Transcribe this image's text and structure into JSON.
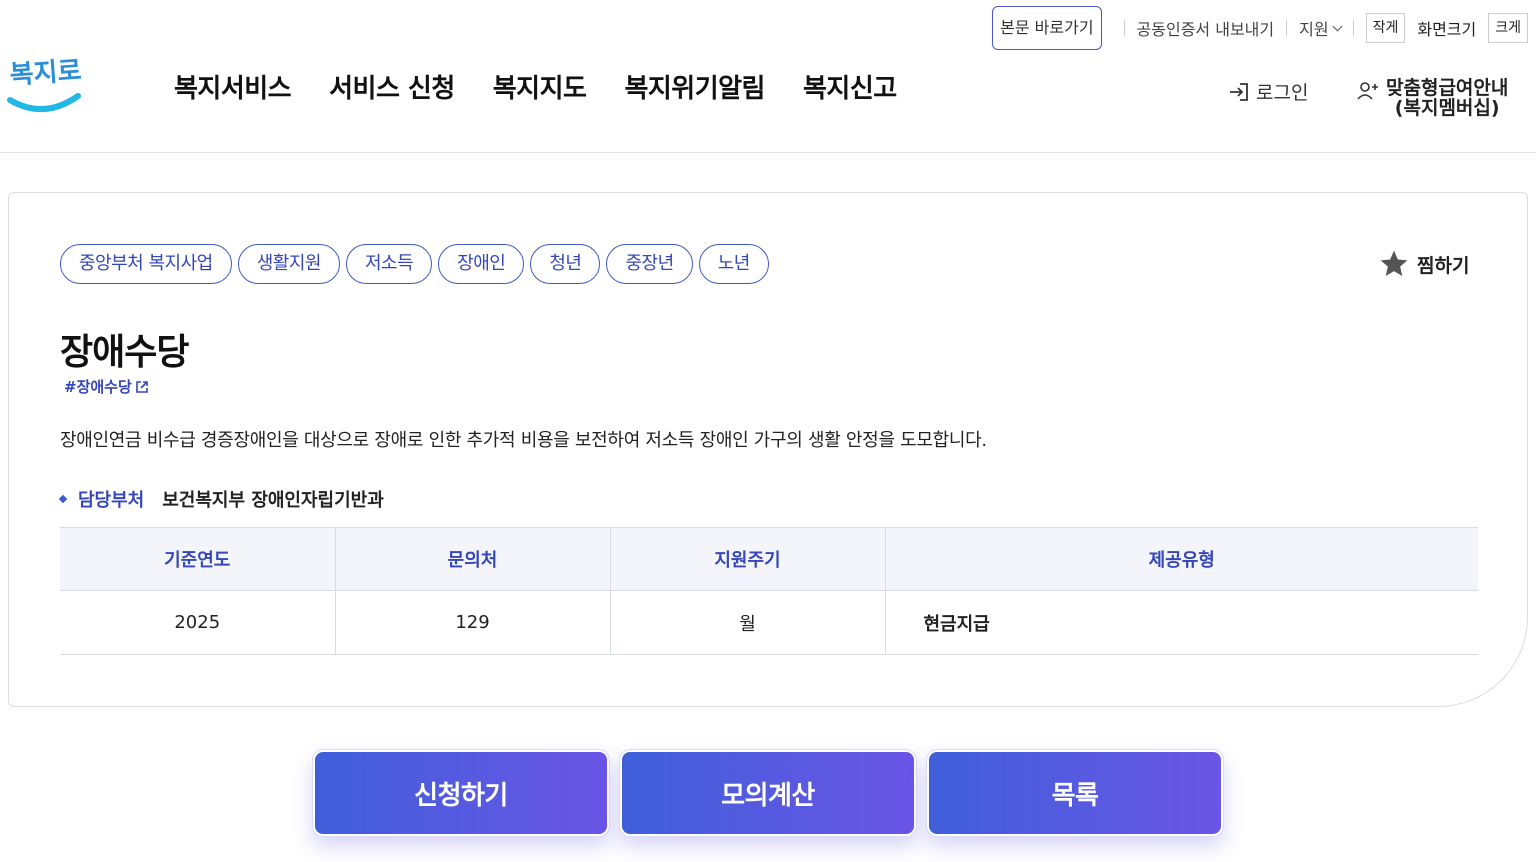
{
  "util_bar": {
    "skip_link": "본문 바로가기",
    "cert_export": "공동인증서 내보내기",
    "support": "지원",
    "size_small": "작게",
    "size_label": "화면크기",
    "size_large": "크게"
  },
  "logo": {
    "text": "복지로"
  },
  "nav": {
    "items": [
      "복지서비스",
      "서비스 신청",
      "복지지도",
      "복지위기알림",
      "복지신고"
    ],
    "login": "로그인",
    "member_line1": "맞춤형급여안내",
    "member_line2": "(복지멤버십)"
  },
  "detail": {
    "tags": [
      "중앙부처 복지사업",
      "생활지원",
      "저소득",
      "장애인",
      "청년",
      "중장년",
      "노년"
    ],
    "favorite": "찜하기",
    "title": "장애수당",
    "hashtag": "#장애수당",
    "description": "장애인연금 비수급 경증장애인을 대상으로 장애로 인한 추가적 비용을 보전하여 저소득 장애인 가구의 생활 안정을 도모합니다.",
    "dept_label": "담당부처",
    "dept_value": "보건복지부 장애인자립기반과",
    "table": {
      "headers": [
        "기준연도",
        "문의처",
        "지원주기",
        "제공유형"
      ],
      "row": [
        "2025",
        "129",
        "월",
        "현금지급"
      ]
    }
  },
  "actions": {
    "apply": "신청하기",
    "simulate": "모의계산",
    "list": "목록"
  },
  "colors": {
    "accent": "#3547b8",
    "button_gradient_start": "#3f5fd9",
    "button_gradient_end": "#6b55e6"
  }
}
